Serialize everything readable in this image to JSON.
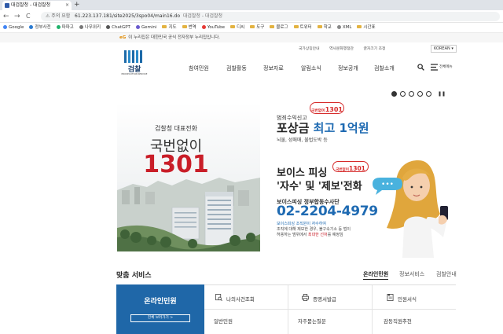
{
  "browser": {
    "tab_title": "대검찰청 - 대검찰청",
    "tab_close": "×",
    "new_tab": "+",
    "nav_back": "←",
    "nav_forward": "→",
    "nav_reload": "C",
    "security_label": "주의 요함",
    "url": "61.223.137.181/site2025/3spo04/main16.do",
    "url_title": "대검찰청 - 대검찰청",
    "bookmarks": [
      "Google",
      "정부사전",
      "파파고",
      "나무위키",
      "ChatGPT",
      "Gemini",
      "지도",
      "번역",
      "YouTube",
      "디씨",
      "도구",
      "블로그",
      "트위터",
      "학교",
      "XML",
      "시간표"
    ]
  },
  "gov_banner": {
    "mark": "eG",
    "text": "이 누리집은 대한민국 공식 전자정부 누리집입니다."
  },
  "util": {
    "links": [
      "국가상징안내",
      "역사문화행정관",
      "글자크기 조정"
    ],
    "language": "KOREAN ▾"
  },
  "logo": {
    "name": "검찰",
    "sub": "PROSECUTION SERVICE"
  },
  "gnb": [
    "참여민원",
    "검찰활동",
    "정보자료",
    "알림소식",
    "정보공개",
    "검찰소개"
  ],
  "header": {
    "menu_label": "전체메뉴"
  },
  "slider": {
    "dot_count": 5,
    "active_index": 0,
    "pause_icon": "❚❚"
  },
  "hero": {
    "left_line1": "검찰청 대표전화",
    "left_line2": "국번없이",
    "left_number": "1301",
    "badge1_prefix": "국번없이",
    "badge1_number": "1301",
    "reward_pre": "범죄수익신고",
    "reward_main": "포상금",
    "reward_highlight": "최고 1억원",
    "reward_sub": "뇌물, 성매매, 불법도박 등",
    "badge2_prefix": "국번없이",
    "badge2_number": "1301",
    "vp_line1": "보이스 피싱",
    "vp_line2": "'자수' 및 '제보'전화",
    "vp_team": "보이스피싱 정부합동수사단",
    "vp_tel": "02-2204-4979",
    "vp_note1": "보이스피싱 조직원이 자수하여",
    "vp_note2": "조직에 대해 제보한 경우, 불구속기소 등 법이",
    "vp_note3_pre": "허용하는 범위에서",
    "vp_note3_red": "최대한 선처",
    "vp_note3_post": "를 예정임",
    "bubble": "•••"
  },
  "services": {
    "title": "맞춤 서비스",
    "tabs": [
      "온라인민원",
      "정보서비스",
      "검찰안내"
    ],
    "active_tab": 0,
    "online_title": "온라인민원",
    "online_button": "전체 보러가기 >",
    "items_row1": [
      {
        "label": "나의사건조회",
        "icon": "case-search-icon"
      },
      {
        "label": "증명서발급",
        "icon": "printer-icon"
      },
      {
        "label": "민원서식",
        "icon": "form-icon"
      }
    ],
    "items_row2": [
      {
        "label": "일반민원"
      },
      {
        "label": "자주묻는질문"
      },
      {
        "label": "감동직원추천"
      }
    ]
  },
  "colors": {
    "accent_blue": "#1f67a8",
    "accent_red": "#c91e28",
    "tel_blue": "#1e6ab2"
  }
}
